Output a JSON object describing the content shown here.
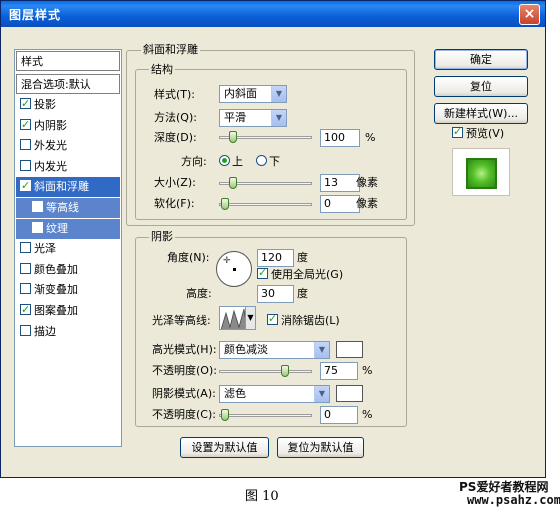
{
  "window": {
    "title": "图层样式",
    "close": "×"
  },
  "styles": {
    "header": "样式",
    "blend": "混合选项:默认",
    "items": [
      {
        "label": "投影",
        "checked": true
      },
      {
        "label": "内阴影",
        "checked": true
      },
      {
        "label": "外发光",
        "checked": false
      },
      {
        "label": "内发光",
        "checked": false
      },
      {
        "label": "斜面和浮雕",
        "checked": true,
        "selected": true
      },
      {
        "label": "等高线",
        "checked": false,
        "sub": true
      },
      {
        "label": "纹理",
        "checked": false,
        "sub": true
      },
      {
        "label": "光泽",
        "checked": false
      },
      {
        "label": "颜色叠加",
        "checked": false
      },
      {
        "label": "渐变叠加",
        "checked": false
      },
      {
        "label": "图案叠加",
        "checked": true
      },
      {
        "label": "描边",
        "checked": false
      }
    ]
  },
  "bevel": {
    "section_title": "斜面和浮雕",
    "structure_title": "结构",
    "style_label": "样式(T):",
    "style_value": "内斜面",
    "method_label": "方法(Q):",
    "method_value": "平滑",
    "depth_label": "深度(D):",
    "depth_value": "100",
    "depth_unit": "%",
    "depth_level": 0.1,
    "direction_label": "方向:",
    "dir_up": "上",
    "dir_down": "下",
    "size_label": "大小(Z):",
    "size_value": "13",
    "size_unit": "像素",
    "size_level": 0.1,
    "soften_label": "软化(F):",
    "soften_value": "0",
    "soften_unit": "像素",
    "soften_level": 0.0
  },
  "shading": {
    "title": "阴影",
    "angle_label": "角度(N):",
    "angle_value": "120",
    "angle_unit": "度",
    "global_light": "使用全局光(G)",
    "altitude_label": "高度:",
    "altitude_value": "30",
    "altitude_unit": "度",
    "gloss_label": "光泽等高线:",
    "antialias": "消除锯齿(L)",
    "highlight_label": "高光模式(H):",
    "highlight_value": "颜色减淡",
    "highlight_opacity_label": "不透明度(O):",
    "highlight_opacity_value": "75",
    "highlight_opacity_unit": "%",
    "highlight_opacity_level": 0.75,
    "shadow_label": "阴影模式(A):",
    "shadow_value": "滤色",
    "shadow_opacity_label": "不透明度(C):",
    "shadow_opacity_value": "0",
    "shadow_opacity_unit": "%",
    "shadow_opacity_level": 0.0
  },
  "footer": {
    "make_default": "设置为默认值",
    "reset_default": "复位为默认值"
  },
  "right": {
    "ok": "确定",
    "reset": "复位",
    "new_style": "新建样式(W)...",
    "preview": "预览(V)"
  },
  "caption": "图 10",
  "watermark": {
    "line1": "PS爱好者教程网",
    "line2": "www.psahz.com"
  }
}
